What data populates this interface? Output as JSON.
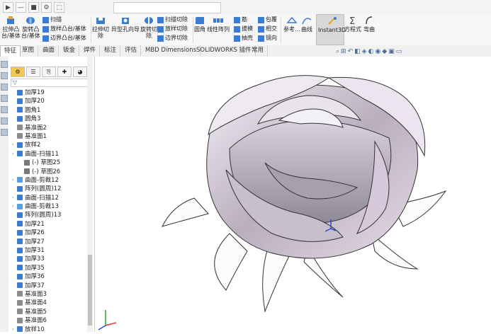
{
  "quick_access": [
    "▶",
    "—",
    "■",
    "⚙",
    "⬚"
  ],
  "ribbon": {
    "groups": [
      {
        "label": "拉伸凸\n台/基体"
      },
      {
        "label": "旋转凸\n台/基体"
      },
      {
        "label": "拉伸切\n除"
      },
      {
        "label": "异型孔向导"
      },
      {
        "label": "旋转切\n除"
      },
      {
        "label": "圆角"
      },
      {
        "label": "线性阵列"
      },
      {
        "label": "参考..."
      },
      {
        "label": "曲线"
      },
      {
        "label": "Instant3D"
      },
      {
        "label": "方程式"
      },
      {
        "label": "弯曲"
      }
    ],
    "small": [
      "扫描",
      "放样凸台/基体",
      "边界凸台/基体",
      "扫描切除",
      "放样切除",
      "边界切除",
      "筋",
      "拔模",
      "抽壳",
      "包覆",
      "相交",
      "镜向"
    ]
  },
  "tabs": [
    "特征",
    "草图",
    "曲面",
    "钣金",
    "焊件",
    "标注",
    "评估",
    "MBD Dimensions",
    "SOLIDWORKS 插件",
    "常用"
  ],
  "tree": {
    "filter": "▽",
    "items": [
      {
        "label": "加厚19",
        "kind": "thicken"
      },
      {
        "label": "加厚20",
        "kind": "thicken"
      },
      {
        "label": "圆角1",
        "kind": "fillet"
      },
      {
        "label": "圆角3",
        "kind": "fillet"
      },
      {
        "label": "基准面2",
        "kind": "plane"
      },
      {
        "label": "基准面1",
        "kind": "plane"
      },
      {
        "label": "放样2",
        "kind": "loft"
      },
      {
        "label": "曲面-扫描11",
        "kind": "surface"
      },
      {
        "label": "(-) 草图25",
        "kind": "sketch"
      },
      {
        "label": "(-) 草图26",
        "kind": "sketch"
      },
      {
        "label": "曲面-剪裁12",
        "kind": "trim"
      },
      {
        "label": "阵列(圆周)12",
        "kind": "pattern"
      },
      {
        "label": "曲面-扫描12",
        "kind": "surface"
      },
      {
        "label": "曲面-剪裁13",
        "kind": "trim"
      },
      {
        "label": "阵列(圆周)13",
        "kind": "pattern"
      },
      {
        "label": "加厚21",
        "kind": "thicken"
      },
      {
        "label": "加厚26",
        "kind": "thicken"
      },
      {
        "label": "加厚27",
        "kind": "thicken"
      },
      {
        "label": "加厚31",
        "kind": "thicken"
      },
      {
        "label": "加厚33",
        "kind": "thicken"
      },
      {
        "label": "加厚35",
        "kind": "thicken"
      },
      {
        "label": "加厚36",
        "kind": "thicken"
      },
      {
        "label": "加厚37",
        "kind": "thicken"
      },
      {
        "label": "基准面3",
        "kind": "plane"
      },
      {
        "label": "基准面4",
        "kind": "plane"
      },
      {
        "label": "基准面5",
        "kind": "plane"
      },
      {
        "label": "基准面6",
        "kind": "plane"
      },
      {
        "label": "放样10",
        "kind": "loft"
      }
    ]
  },
  "colors": {
    "thicken": "#3b7bd2",
    "fillet": "#3b7bd2",
    "plane": "#8c8c8c",
    "loft": "#3b7bd2",
    "surface": "#3b7bd2",
    "sketch": "#777777",
    "trim": "#5aa0e0",
    "pattern": "#3b7bd2"
  }
}
